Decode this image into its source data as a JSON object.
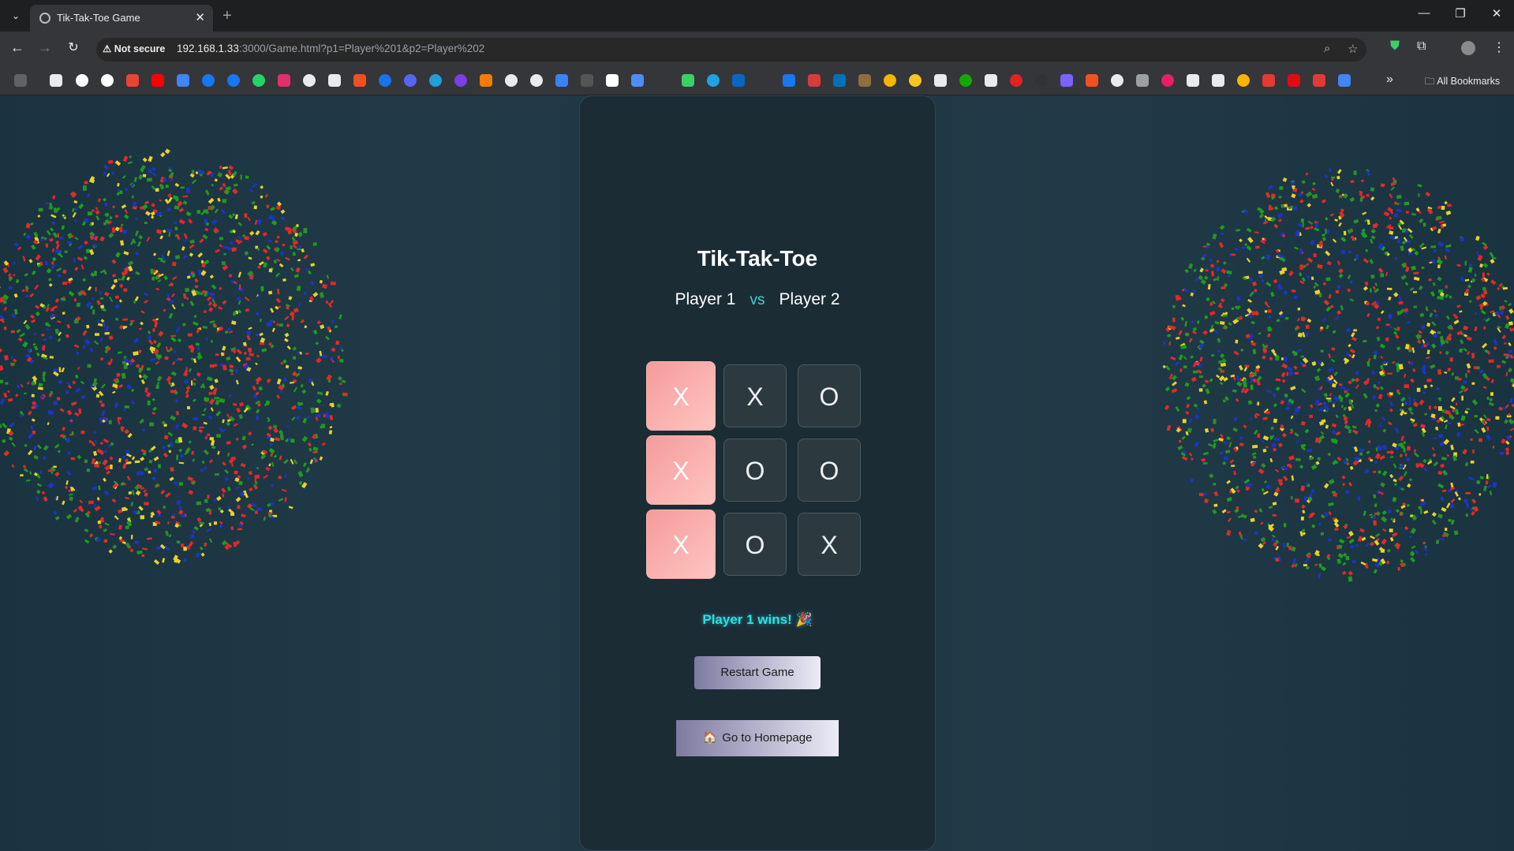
{
  "browser": {
    "tab_title": "Tik-Tak-Toe Game",
    "new_tab": "+",
    "security_label": "Not secure",
    "url_host": "192.168.1.33",
    "url_rest": ":3000/Game.html?p1=Player%201&p2=Player%202",
    "all_bookmarks_label": "All Bookmarks"
  },
  "game": {
    "title": "Tik-Tak-Toe",
    "player1": "Player 1",
    "vs": "vs",
    "player2": "Player 2",
    "board": [
      {
        "mark": "X",
        "winning": true
      },
      {
        "mark": "X",
        "winning": false
      },
      {
        "mark": "O",
        "winning": false
      },
      {
        "mark": "X",
        "winning": true
      },
      {
        "mark": "O",
        "winning": false
      },
      {
        "mark": "O",
        "winning": false
      },
      {
        "mark": "X",
        "winning": true
      },
      {
        "mark": "O",
        "winning": false
      },
      {
        "mark": "X",
        "winning": false
      }
    ],
    "status": "Player 1 wins! 🎉",
    "restart_label": "Restart Game",
    "home_label": "Go to Homepage",
    "home_icon": "🏠"
  },
  "colors": {
    "accent": "#2ce0e4",
    "win_cell": "#f8a9a6",
    "card_bg": "#1b2c35"
  }
}
